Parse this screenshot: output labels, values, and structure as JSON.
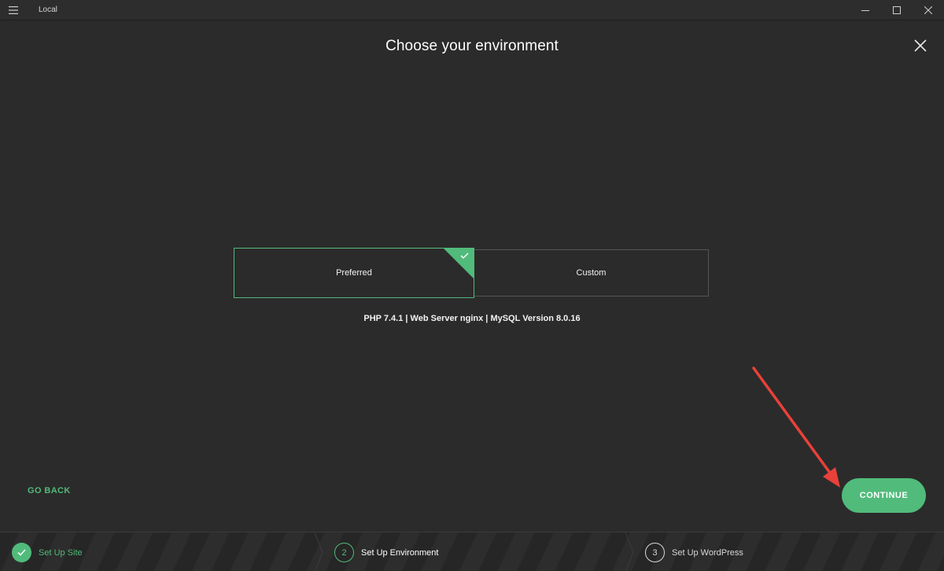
{
  "window": {
    "title": "Local",
    "menu_icon": "hamburger-icon",
    "controls": [
      "minimize-icon",
      "maximize-icon",
      "close-window-icon"
    ]
  },
  "main": {
    "title": "Choose your environment",
    "close_icon": "close-icon",
    "options": {
      "preferred_label": "Preferred",
      "custom_label": "Custom",
      "selected": "Preferred",
      "selected_icon": "check-icon"
    },
    "environment_summary": "PHP 7.4.1 | Web Server nginx | MySQL Version 8.0.16",
    "go_back_label": "GO BACK",
    "continue_label": "CONTINUE"
  },
  "steps": [
    {
      "number": "1",
      "label": "Set Up Site",
      "status": "done",
      "icon": "check-icon"
    },
    {
      "number": "2",
      "label": "Set Up Environment",
      "status": "current"
    },
    {
      "number": "3",
      "label": "Set Up WordPress",
      "status": "upcoming"
    }
  ],
  "colors": {
    "accent": "#51bb7b",
    "background": "#2b2b2b",
    "annotation_arrow": "#e8413a"
  }
}
